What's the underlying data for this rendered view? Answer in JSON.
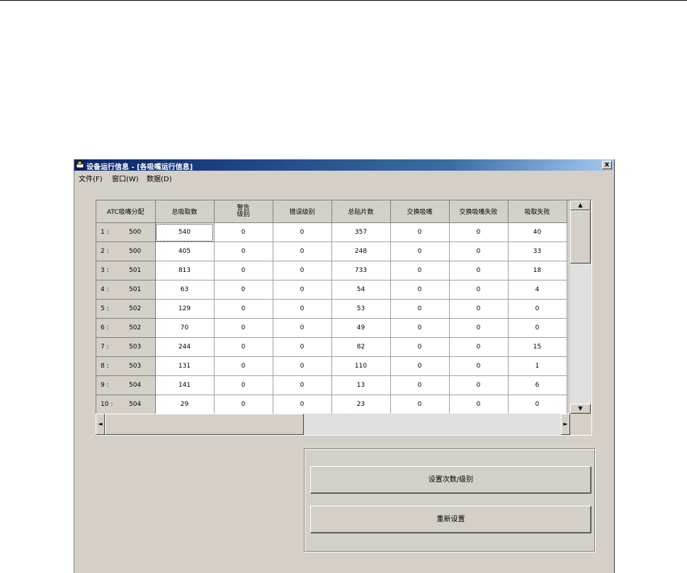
{
  "window": {
    "title": "设备运行信息 - [各吸嘴运行信息]",
    "close_label": "x"
  },
  "menu": [
    {
      "label": "文件(F)"
    },
    {
      "label": "窗口(W)"
    },
    {
      "label": "数据(D)"
    }
  ],
  "grid": {
    "columns": [
      "ATC吸嘴分配",
      "总吸取数",
      "警告级别",
      "错误级别",
      "总贴片数",
      "交换吸嘴",
      "交换吸嘴失败",
      "吸取失败"
    ],
    "col2_lines": [
      "警告",
      "级别"
    ],
    "rows": [
      {
        "index": "1 :",
        "atc": "500",
        "cells": [
          "540",
          "0",
          "0",
          "357",
          "0",
          "0",
          "40"
        ]
      },
      {
        "index": "2 :",
        "atc": "500",
        "cells": [
          "405",
          "0",
          "0",
          "248",
          "0",
          "0",
          "33"
        ]
      },
      {
        "index": "3 :",
        "atc": "501",
        "cells": [
          "813",
          "0",
          "0",
          "733",
          "0",
          "0",
          "18"
        ]
      },
      {
        "index": "4 :",
        "atc": "501",
        "cells": [
          "63",
          "0",
          "0",
          "54",
          "0",
          "0",
          "4"
        ]
      },
      {
        "index": "5 :",
        "atc": "502",
        "cells": [
          "129",
          "0",
          "0",
          "53",
          "0",
          "0",
          "0"
        ]
      },
      {
        "index": "6 :",
        "atc": "502",
        "cells": [
          "70",
          "0",
          "0",
          "49",
          "0",
          "0",
          "0"
        ]
      },
      {
        "index": "7 :",
        "atc": "503",
        "cells": [
          "244",
          "0",
          "0",
          "82",
          "0",
          "0",
          "15"
        ]
      },
      {
        "index": "8 :",
        "atc": "503",
        "cells": [
          "131",
          "0",
          "0",
          "110",
          "0",
          "0",
          "1"
        ]
      },
      {
        "index": "9 :",
        "atc": "504",
        "cells": [
          "141",
          "0",
          "0",
          "13",
          "0",
          "0",
          "6"
        ]
      },
      {
        "index": "10 :",
        "atc": "504",
        "cells": [
          "29",
          "0",
          "0",
          "23",
          "0",
          "0",
          "0"
        ]
      }
    ]
  },
  "buttons": {
    "set_count_level": "设置次数/级别",
    "reset": "重新设置"
  },
  "icons": {
    "scroll_up": "▲",
    "scroll_down": "▼",
    "scroll_left": "◄",
    "scroll_right": "►"
  }
}
